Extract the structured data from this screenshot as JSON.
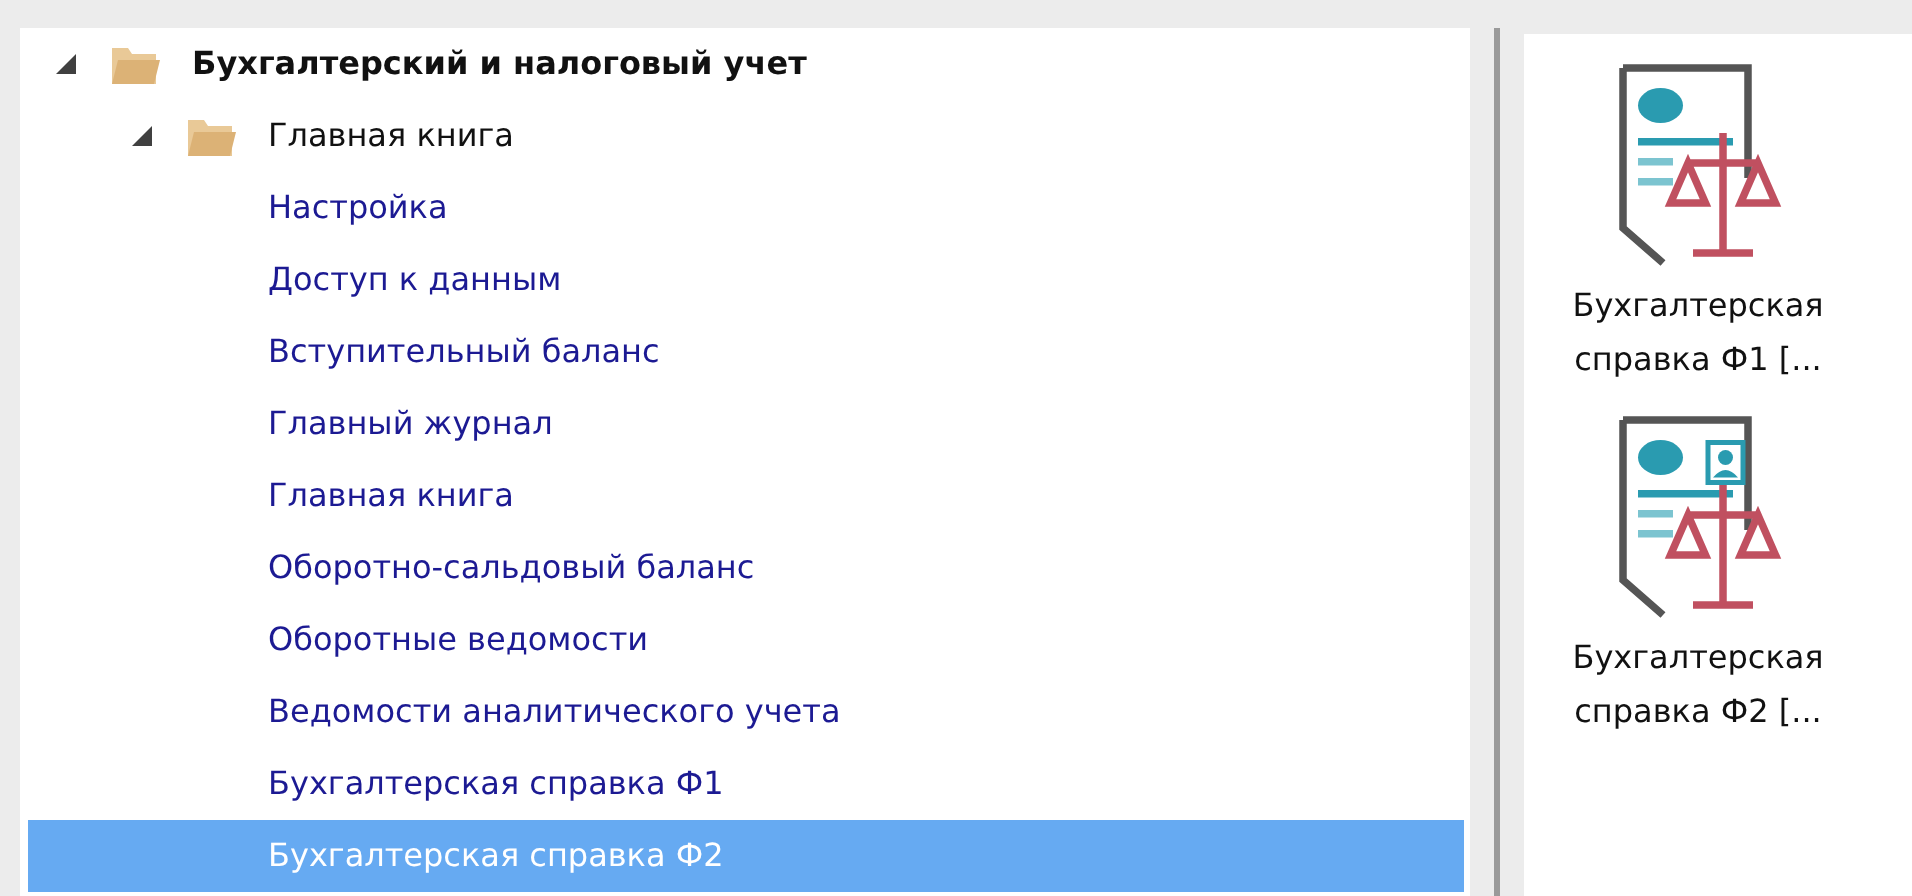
{
  "tree": [
    {
      "label": "Бухгалтерский и налоговый учет",
      "kind": "folder",
      "expanded": true,
      "selected": false,
      "children": [
        {
          "label": "Главная книга",
          "kind": "folder",
          "expanded": true,
          "selected": false,
          "children": [
            {
              "label": "Настройка",
              "kind": "leaf",
              "selected": false
            },
            {
              "label": "Доступ к данным",
              "kind": "leaf",
              "selected": false
            },
            {
              "label": "Вступительный баланс",
              "kind": "leaf",
              "selected": false
            },
            {
              "label": "Главный журнал",
              "kind": "leaf",
              "selected": false
            },
            {
              "label": "Главная книга",
              "kind": "leaf",
              "selected": false
            },
            {
              "label": "Оборотно-сальдовый баланс",
              "kind": "leaf",
              "selected": false
            },
            {
              "label": "Оборотные ведомости",
              "kind": "leaf",
              "selected": false
            },
            {
              "label": "Ведомости аналитического учета",
              "kind": "leaf",
              "selected": false
            },
            {
              "label": "Бухгалтерская справка Ф1",
              "kind": "leaf",
              "selected": false
            },
            {
              "label": "Бухгалтерская справка Ф2",
              "kind": "leaf",
              "selected": true
            }
          ]
        }
      ]
    }
  ],
  "tiles": [
    {
      "label": "Бухгалтерская справка Ф1 [...",
      "kind": "f1"
    },
    {
      "label": "Бухгалтерская справка Ф2 [...",
      "kind": "f2"
    }
  ]
}
